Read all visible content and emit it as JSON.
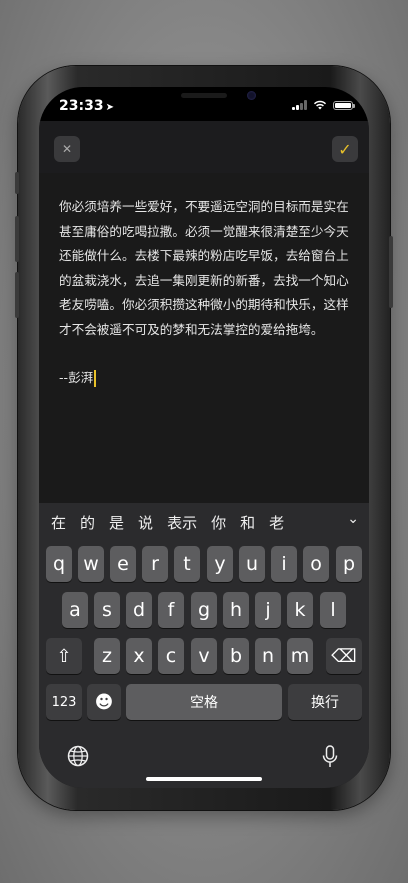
{
  "status": {
    "time": "23:33",
    "location_arrow": "➤"
  },
  "nav": {
    "close_glyph": "✕",
    "done_glyph": "✓"
  },
  "editor": {
    "body": "你必须培养一些爱好，不要遥远空洞的目标而是实在甚至庸俗的吃喝拉撒。必须一觉醒来很清楚至少今天还能做什么。去楼下最辣的粉店吃早饭，去给窗台上的盆栽浇水，去追一集刚更新的新番，去找一个知心老友唠嗑。你必须积攒这种微小的期待和快乐，这样才不会被遥不可及的梦和无法掌控的爱给拖垮。",
    "signature": "--彭湃"
  },
  "keyboard": {
    "candidates": [
      "在",
      "的",
      "是",
      "说",
      "表示",
      "你",
      "和",
      "老"
    ],
    "expand_glyph": "⌄",
    "row1": [
      "q",
      "w",
      "e",
      "r",
      "t",
      "y",
      "u",
      "i",
      "o",
      "p"
    ],
    "row2": [
      "a",
      "s",
      "d",
      "f",
      "g",
      "h",
      "j",
      "k",
      "l"
    ],
    "row3": [
      "z",
      "x",
      "c",
      "v",
      "b",
      "n",
      "m"
    ],
    "shift_glyph": "⇧",
    "delete_glyph": "⌫",
    "numbers_label": "123",
    "emoji_glyph": "☻",
    "space_label": "空格",
    "return_label": "换行"
  },
  "colors": {
    "accent": "#e8c12a",
    "key": "#5d5d5f",
    "key_dark": "#3d3d3f",
    "keyboard_bg": "#2b2b2d"
  }
}
